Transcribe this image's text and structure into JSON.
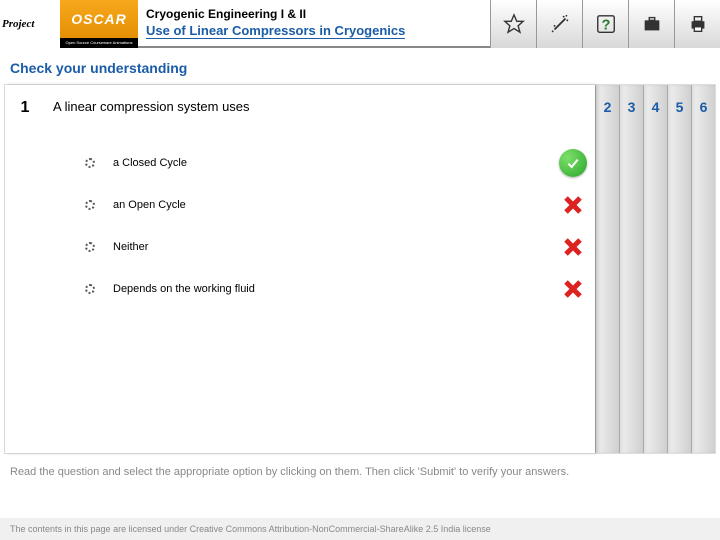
{
  "header": {
    "logo_project": "Project",
    "logo_oscar": "OSCAR",
    "logo_oscar_sub": "Open Source Courseware Animations Repository",
    "course_title": "Cryogenic Engineering I & II",
    "lesson_title": "Use of Linear Compressors in Cryogenics"
  },
  "toolbar_icons": [
    "star-icon",
    "wand-icon",
    "help-icon",
    "briefcase-icon",
    "print-icon"
  ],
  "section_title": "Check your understanding",
  "quiz": {
    "current_num": "1",
    "question": "A linear compression system uses",
    "options": [
      {
        "label": "a Closed Cycle",
        "mark": "correct"
      },
      {
        "label": "an Open Cycle",
        "mark": "wrong"
      },
      {
        "label": "Neither",
        "mark": "wrong"
      },
      {
        "label": "Depends on the working fluid",
        "mark": "wrong"
      }
    ],
    "tabs": [
      "2",
      "3",
      "4",
      "5",
      "6"
    ]
  },
  "instruction": "Read the question and select the appropriate option by clicking on them. Then click 'Submit' to verify your answers.",
  "license": "The contents in this page are licensed under Creative Commons Attribution-NonCommercial-ShareAlike 2.5 India license"
}
